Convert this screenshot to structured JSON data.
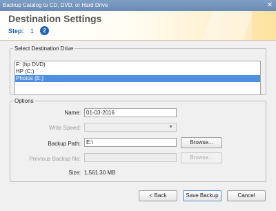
{
  "window": {
    "title": "Backup Catalog to CD, DVD, or Hard Drive",
    "close_glyph": "✕"
  },
  "header": {
    "title": "Destination Settings",
    "step_label": "Step:",
    "step1": "1",
    "step2": "2"
  },
  "drive_group": {
    "legend": "Select Destination Drive",
    "items": [
      {
        "label": "F: (hp DVD)",
        "selected": false
      },
      {
        "label": "HP (C:)",
        "selected": false
      },
      {
        "label": "Photos (E:)",
        "selected": true
      }
    ]
  },
  "options": {
    "legend": "Options",
    "name_label": "Name:",
    "name_value": "01-03-2016",
    "write_speed_label": "Write Speed:",
    "write_speed_value": "",
    "backup_path_label": "Backup Path:",
    "backup_path_value": "E:\\",
    "browse_label": "Browse...",
    "previous_backup_label": "Previous Backup file:",
    "previous_backup_value": "",
    "size_label": "Size:",
    "size_value": "1,561.30 MB"
  },
  "footer": {
    "back_label": "< Back",
    "save_label": "Save Backup",
    "cancel_label": "Cancel"
  }
}
